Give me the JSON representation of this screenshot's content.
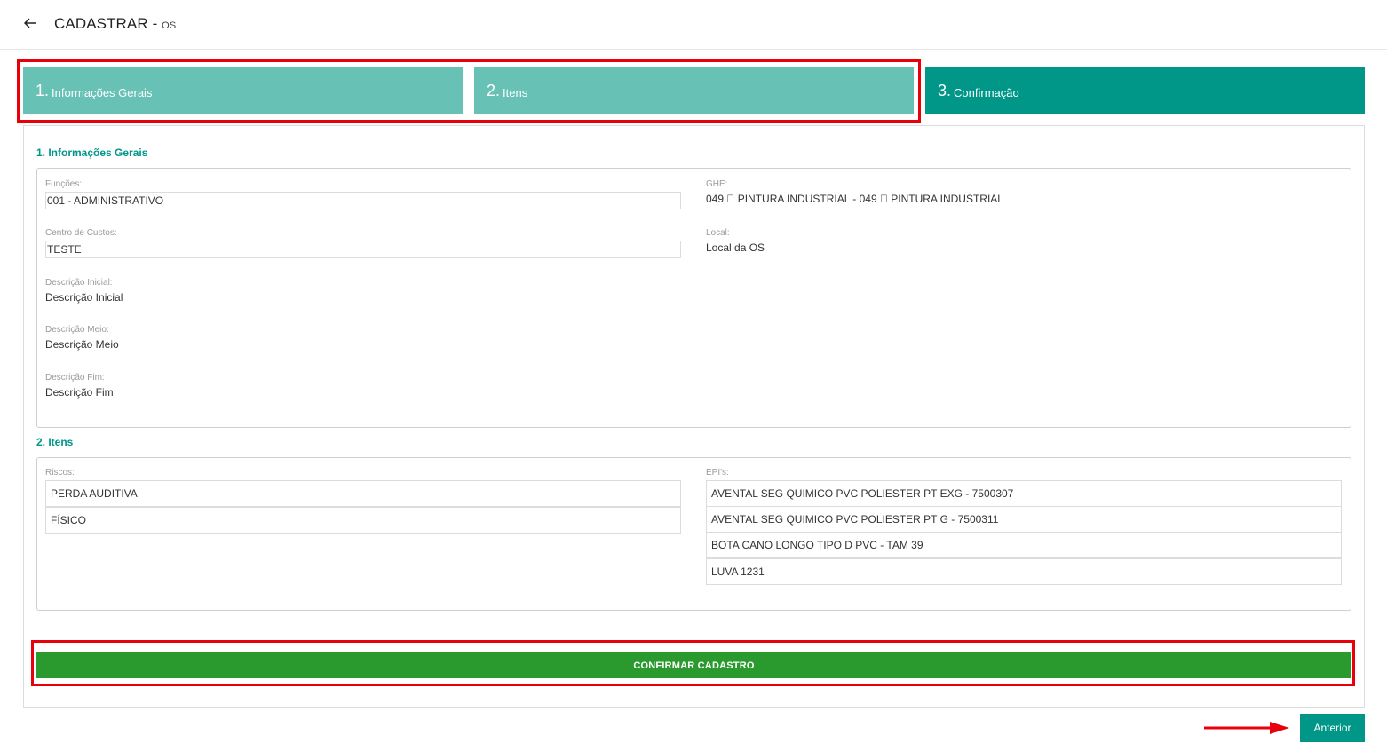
{
  "header": {
    "title": "CADASTRAR",
    "separator": " - ",
    "subtitle": "OS"
  },
  "steps": [
    {
      "number": "1.",
      "label": "Informações Gerais"
    },
    {
      "number": "2.",
      "label": "Itens"
    },
    {
      "number": "3.",
      "label": "Confirmação"
    }
  ],
  "section1": {
    "title": "1. Informações Gerais",
    "funcoes_label": "Funções:",
    "funcoes_value": "001 - ADMINISTRATIVO",
    "ghe_label": "GHE:",
    "ghe_value": "049 \u0000 PINTURA INDUSTRIAL - 049 \u0000 PINTURA INDUSTRIAL",
    "centro_label": "Centro de Custos:",
    "centro_value": "TESTE",
    "local_label": "Local:",
    "local_value": "Local da OS",
    "desc_inicial_label": "Descrição Inicial:",
    "desc_inicial_value": "Descrição Inicial",
    "desc_meio_label": "Descrição Meio:",
    "desc_meio_value": "Descrição Meio",
    "desc_fim_label": "Descrição Fim:",
    "desc_fim_value": "Descrição Fim"
  },
  "section2": {
    "title": "2. Itens",
    "riscos_label": "Riscos:",
    "riscos": [
      "PERDA AUDITIVA",
      "FÍSICO"
    ],
    "epis_label": "EPI's:",
    "epis": [
      "AVENTAL SEG QUIMICO PVC POLIESTER PT EXG - 7500307",
      "AVENTAL SEG QUIMICO PVC POLIESTER PT G - 7500311",
      "BOTA CANO LONGO TIPO D PVC - TAM 39",
      "LUVA 1231"
    ]
  },
  "actions": {
    "confirm_label": "CONFIRMAR CADASTRO",
    "previous_label": "Anterior"
  },
  "colors": {
    "accent": "#009688",
    "step_done": "#68c1b5",
    "confirm": "#2a9a2e",
    "highlight": "#e8000b"
  }
}
